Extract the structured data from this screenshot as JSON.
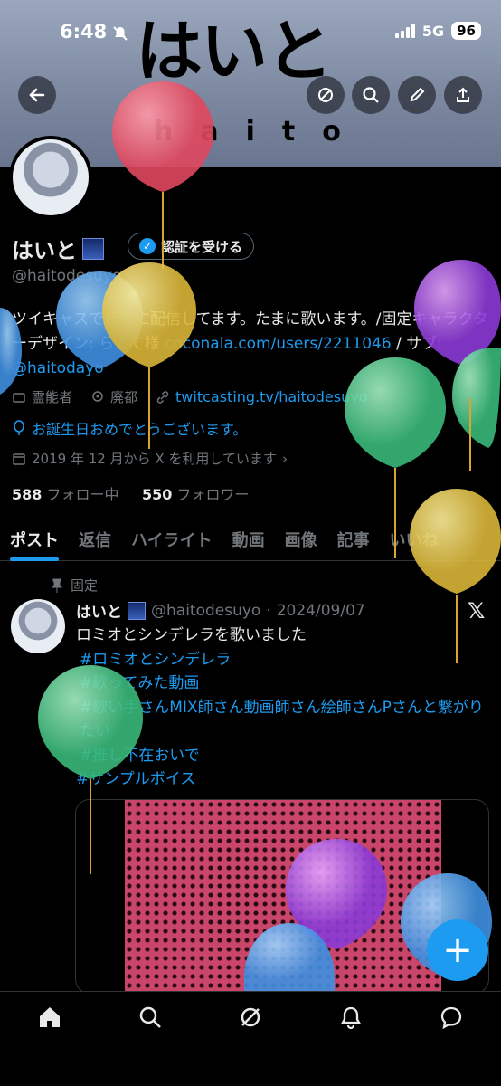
{
  "status": {
    "time": "6:48",
    "network": "5G",
    "battery": "96"
  },
  "banner": {
    "logo_text": "はいと",
    "logo_sub": "haito"
  },
  "profile": {
    "name": "はいと",
    "verify_button": "認証を受ける",
    "handle": "@haitodesuyo",
    "bio_text": "ツイキャスで日曜に配信してます。たまに歌います。/固定キャラクターデザイン: らてて様 ",
    "bio_link1": "coconala.com/users/2211046",
    "bio_sep": " / サブ: ",
    "bio_link2": "@haitodayo",
    "category": "霊能者",
    "location": "廃都",
    "website": "twitcasting.tv/haitodesuyo",
    "birthday": "お誕生日おめでとうございます。",
    "joined": "2019 年 12 月から X を利用しています",
    "following_count": "588",
    "following_label": "フォロー中",
    "followers_count": "550",
    "followers_label": "フォロワー"
  },
  "tabs": [
    "ポスト",
    "返信",
    "ハイライト",
    "動画",
    "画像",
    "記事",
    "いいね"
  ],
  "post": {
    "pinned_label": "固定",
    "name": "はいと",
    "handle": "@haitodesuyo",
    "date": "2024/09/07",
    "text": "ロミオとシンデレラを歌いました",
    "hashtags": [
      "#ロミオとシンデレラ",
      "#歌ってみた動画",
      "#歌い手さんMIX師さん動画師さん絵師さんPさんと繋がりたい",
      "#推し不在おいで",
      "#サンプルボイス"
    ]
  },
  "colors": {
    "accent": "#1d9bf0",
    "background": "#000000",
    "text": "#e7e9ea",
    "muted": "#71767b"
  }
}
